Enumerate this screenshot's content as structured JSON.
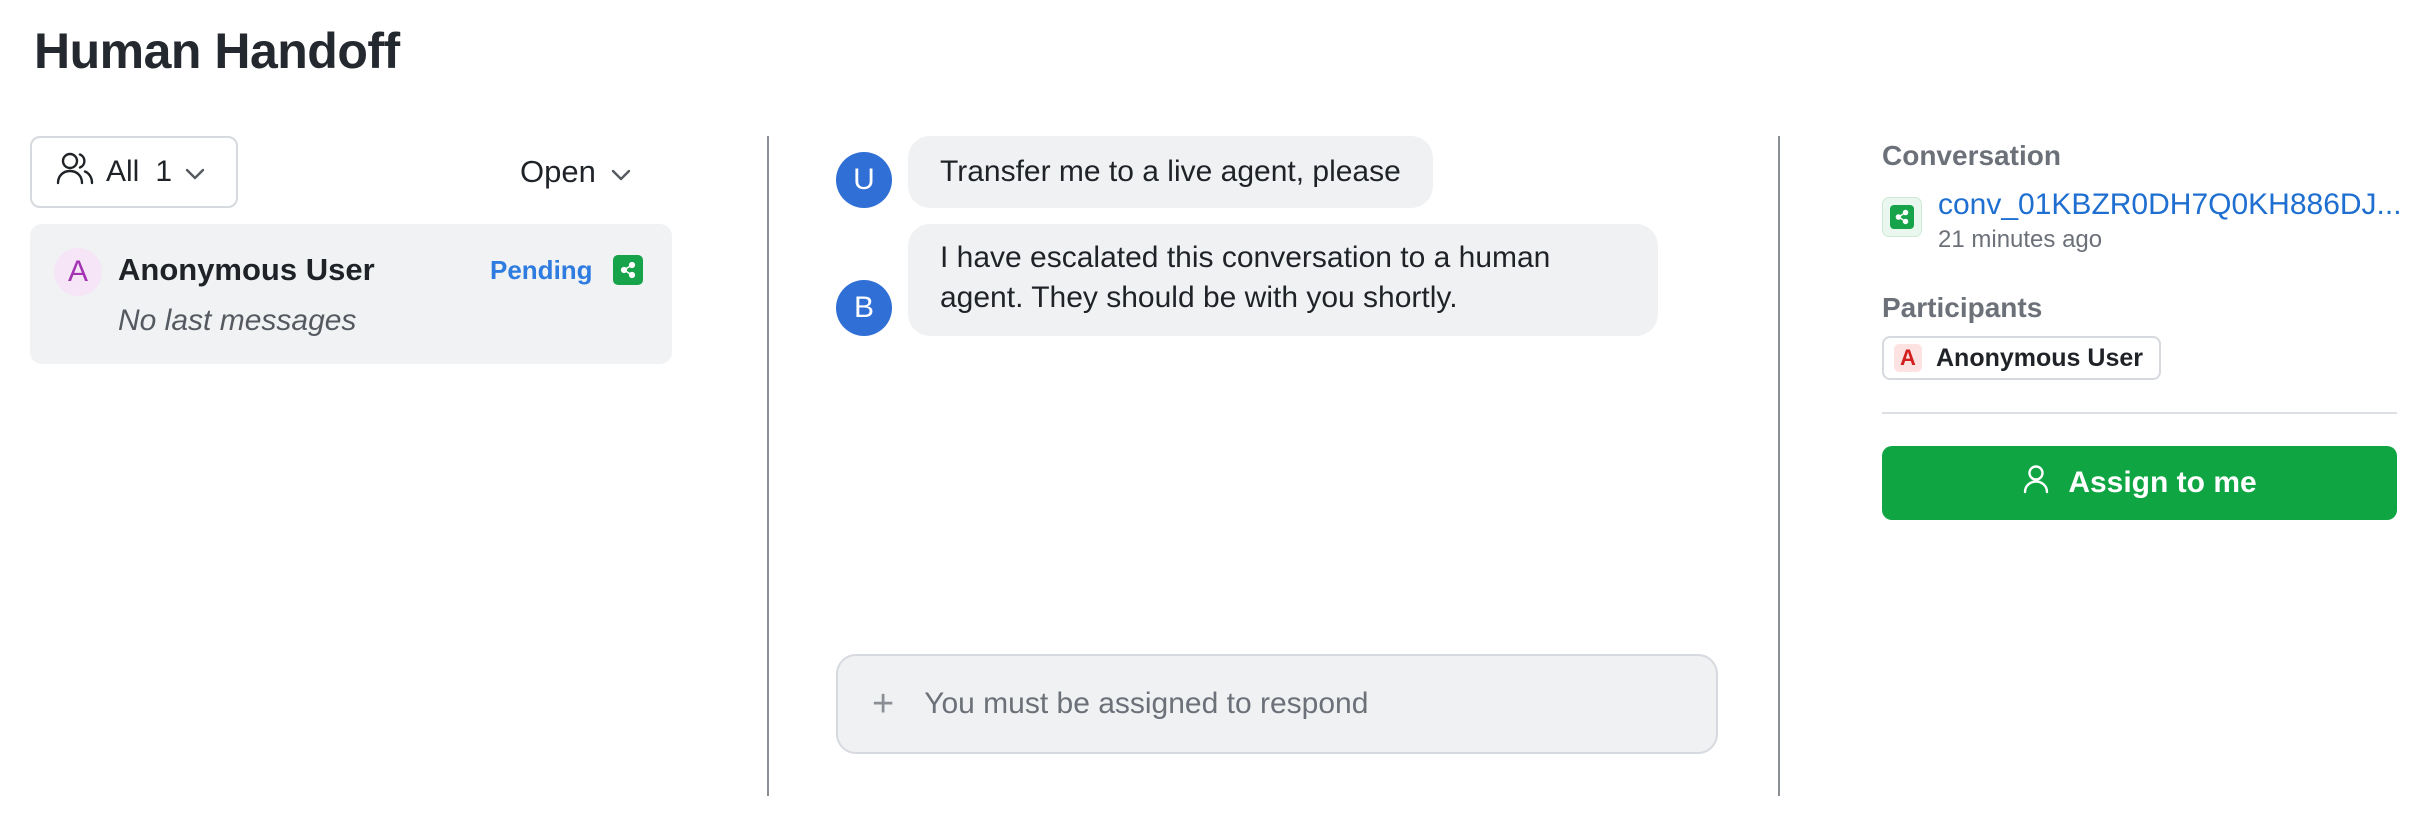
{
  "page": {
    "title": "Human Handoff"
  },
  "filters": {
    "assignee_label": "All",
    "assignee_count": "1",
    "status_label": "Open"
  },
  "conversation_list": [
    {
      "avatar_letter": "A",
      "name": "Anonymous User",
      "status": "Pending",
      "last_message": "No last messages"
    }
  ],
  "chat": {
    "messages": [
      {
        "sender_initial": "U",
        "text": "Transfer me to a live agent, please"
      },
      {
        "sender_initial": "B",
        "text_line1": "I have escalated this conversation to a human",
        "text_line2": "agent. They should be with you shortly."
      }
    ],
    "composer_placeholder": "You must be assigned to respond"
  },
  "details": {
    "conversation_heading": "Conversation",
    "conversation_id": "conv_01KBZR0DH7Q0KH886DJ...",
    "conversation_time": "21 minutes ago",
    "participants_heading": "Participants",
    "participants": [
      {
        "initial": "A",
        "name": "Anonymous User"
      }
    ],
    "assign_label": "Assign to me"
  },
  "colors": {
    "accent_green": "#0fa542",
    "link_blue": "#1f6fd1",
    "avatar_blue": "#2f6fd6",
    "pending_blue": "#2f7ce0"
  }
}
